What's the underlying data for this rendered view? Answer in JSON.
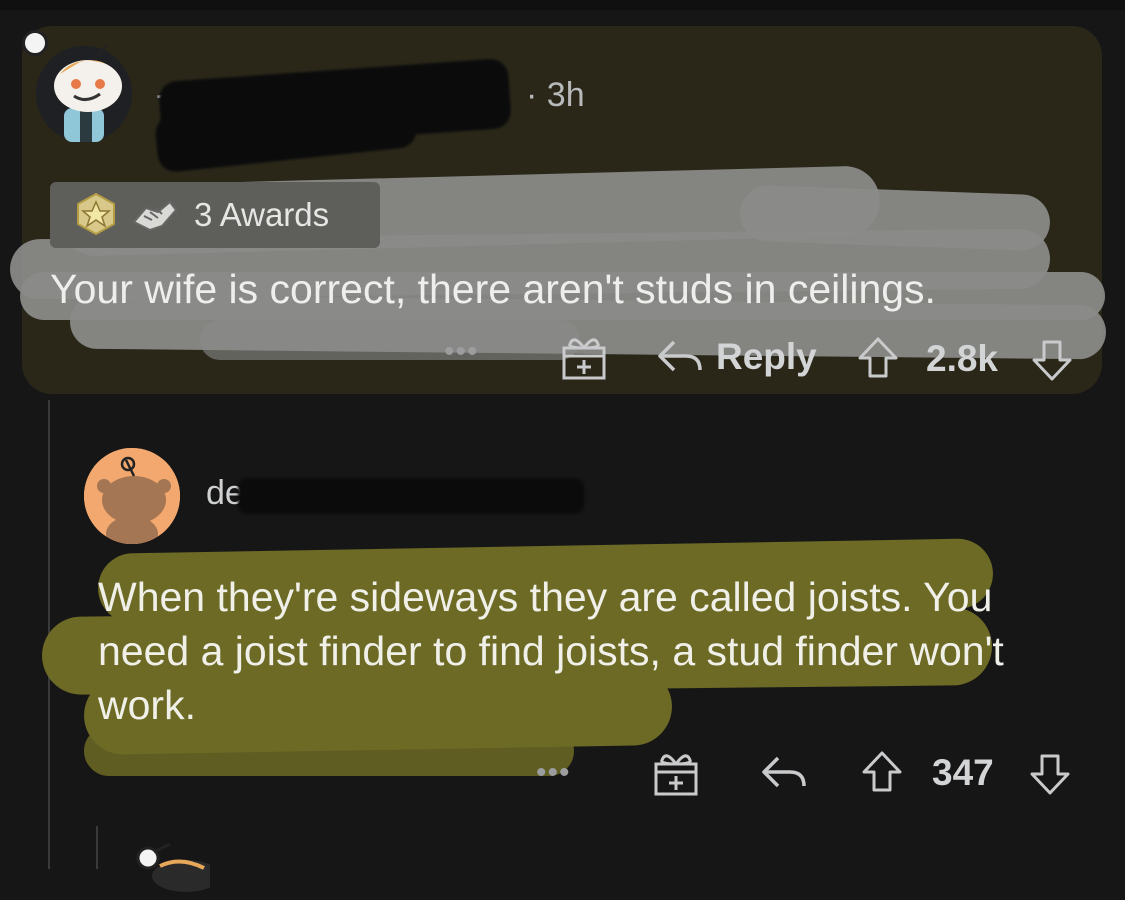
{
  "comment1": {
    "author_visible": "-",
    "separator": "·",
    "age": "3h",
    "awards_label": "3 Awards",
    "body": "Your wife is correct, there aren't studs in ceilings.",
    "more_icon": "ellipsis-icon",
    "gift_icon": "gift-award-icon",
    "reply_label": "Reply",
    "score": "2.8k"
  },
  "comment2": {
    "author_visible": "de",
    "body": "When they're sideways they are called joists. You need a joist finder to find joists, a stud finder won't work.",
    "score": "347"
  },
  "colors": {
    "card_bg": "#2a2719",
    "page_bg": "#161617",
    "highlight_yellow": "#6c6a25",
    "highlight_gray": "#8b8c8a"
  }
}
